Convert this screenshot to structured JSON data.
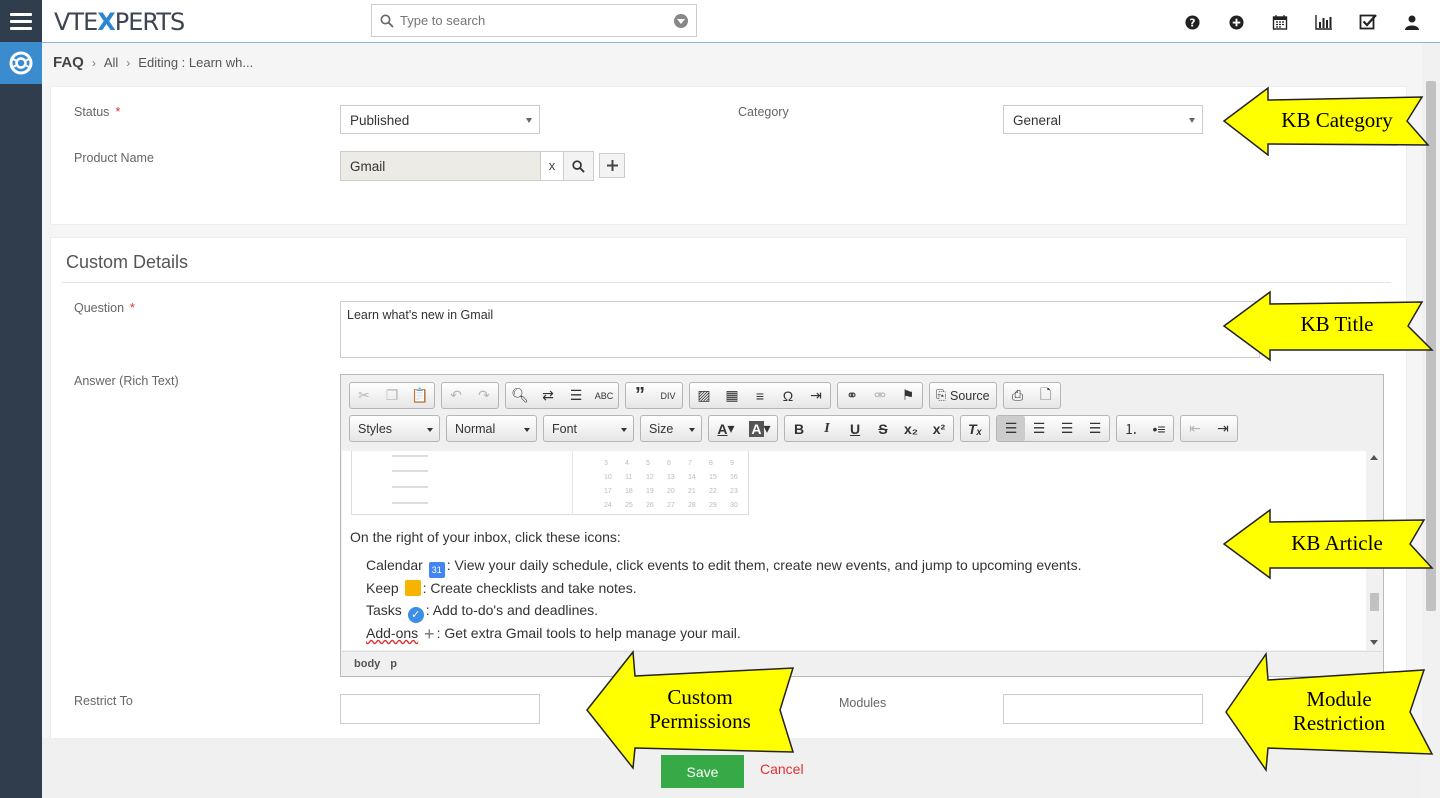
{
  "app": {
    "logo_prefix": "VTE",
    "logo_x": "X",
    "logo_suffix": "PERTS"
  },
  "search": {
    "placeholder": "Type to search"
  },
  "breadcrumb": {
    "root": "FAQ",
    "items": [
      "All",
      "Editing : Learn wh..."
    ]
  },
  "header_icons": [
    "help-icon",
    "add-icon",
    "calendar-icon",
    "reports-icon",
    "tasks-icon",
    "user-icon"
  ],
  "basic": {
    "status_label": "Status",
    "status_value": "Published",
    "category_label": "Category",
    "category_value": "General",
    "product_label": "Product Name",
    "product_value": "Gmail",
    "product_clear": "x",
    "required_mark": "*"
  },
  "custom": {
    "title": "Custom Details",
    "question_label": "Question",
    "question_value": "Learn what's new in Gmail",
    "answer_label": "Answer (Rich Text)",
    "restrict_label": "Restrict To",
    "modules_label": "Modules"
  },
  "editor": {
    "source_label": "Source",
    "styles_label": "Styles",
    "format_label": "Normal",
    "font_label": "Font",
    "size_label": "Size",
    "intro": "On the right of your inbox, click these icons:",
    "items": [
      {
        "name": "Calendar",
        "text": ": View your daily schedule, click events to edit them, create new events, and jump to upcoming events.",
        "icon_color": "#4285f4"
      },
      {
        "name": "Keep",
        "text": ": Create checklists and take notes.",
        "icon_color": "#f6b400"
      },
      {
        "name": "Tasks",
        "text": ": Add to-do's and deadlines.",
        "icon_color": "#3c8ee6"
      },
      {
        "name": "Add-ons",
        "text": ": Get extra Gmail tools to help manage your mail.",
        "icon_color": "#777777"
      }
    ],
    "path": [
      "body",
      "p"
    ],
    "calendar_numbers": [
      [
        "3",
        "4",
        "5",
        "6",
        "7",
        "8",
        "9"
      ],
      [
        "10",
        "11",
        "12",
        "13",
        "14",
        "15",
        "16"
      ],
      [
        "17",
        "18",
        "19",
        "20",
        "21",
        "22",
        "23"
      ],
      [
        "24",
        "25",
        "26",
        "27",
        "28",
        "29",
        "30"
      ]
    ]
  },
  "actions": {
    "save": "Save",
    "cancel": "Cancel"
  },
  "callouts": {
    "kb_category": "KB Category",
    "kb_title": "KB Title",
    "kb_article": "KB Article",
    "custom_permissions_1": "Custom",
    "custom_permissions_2": "Permissions",
    "module_restriction_1": "Module",
    "module_restriction_2": "Restriction"
  },
  "colors": {
    "rail": "#2f3d4c",
    "accent": "#3a8ccf",
    "save": "#35aa47",
    "callout": "#ffff00"
  }
}
